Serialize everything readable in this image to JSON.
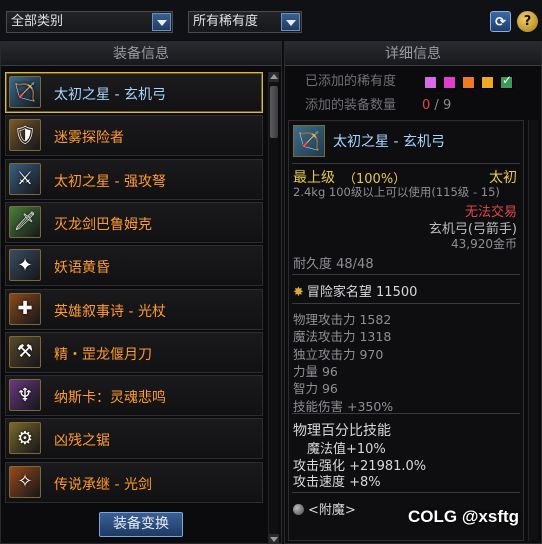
{
  "filters": {
    "category": "全部类别",
    "rarity": "所有稀有度",
    "refresh_icon": "refresh-icon",
    "help_icon": "help-icon",
    "help_label": "?"
  },
  "left_panel": {
    "title": "装备信息",
    "items": [
      {
        "name": "太初之星 - 玄机弓",
        "icon_glyph": "🏹",
        "color": "#3a6e8e",
        "selected": true
      },
      {
        "name": "迷雾探险者",
        "icon_glyph": "🛡",
        "color": "#7a5a2a"
      },
      {
        "name": "太初之星 - 强攻弩",
        "icon_glyph": "⚔",
        "color": "#3a5e7e"
      },
      {
        "name": "灭龙剑巴鲁姆克",
        "icon_glyph": "🗡",
        "color": "#4a7e3a"
      },
      {
        "name": "妖语黄昏",
        "icon_glyph": "✦",
        "color": "#3a4e5e"
      },
      {
        "name": "英雄叙事诗 - 光杖",
        "icon_glyph": "✚",
        "color": "#8a4a1a"
      },
      {
        "name": "精・罡龙偃月刀",
        "icon_glyph": "⚒",
        "color": "#5a4a2a"
      },
      {
        "name": "纳斯卡：灵魂悲鸣",
        "icon_glyph": "♆",
        "color": "#6a3a7e"
      },
      {
        "name": "凶残之锯",
        "icon_glyph": "⚙",
        "color": "#7a6a2a"
      },
      {
        "name": "传说承继 - 光剑",
        "icon_glyph": "✧",
        "color": "#9a4a1a"
      }
    ],
    "swap_button": "装备变换"
  },
  "right_panel": {
    "title": "详细信息",
    "rarity_added_label": "已添加的稀有度",
    "rarity_colors": [
      "#d66ae8",
      "#e43ccc",
      "#f07a1e",
      "#f0a81e",
      "#3a9a5a"
    ],
    "count_label": "添加的装备数量",
    "count_current": "0",
    "count_sep": "/",
    "count_max": "9",
    "detail": {
      "name": "太初之星 - 玄机弓",
      "grade": "最上级",
      "grade_pct": "（100%）",
      "rarity": "太初",
      "weight_level": "2.4kg  100级以上可以使用(115级 - 15)",
      "trade": "无法交易",
      "type": "玄机弓(弓箭手)",
      "price": "43,920金币",
      "durability": "耐久度 48/48",
      "fame": "冒险家名望 11500",
      "stats": [
        "物理攻击力 1582",
        "魔法攻击力 1318",
        "独立攻击力 970",
        "力量 96",
        "智力 96",
        "技能伤害 +350%"
      ],
      "skill_title": "物理百分比技能",
      "skill_lines": [
        "魔法值+10%",
        "攻击强化 +21981.0%",
        "攻击速度 +8%"
      ],
      "enchant": "<附魔>"
    }
  },
  "watermark": "COLG @xsftg"
}
